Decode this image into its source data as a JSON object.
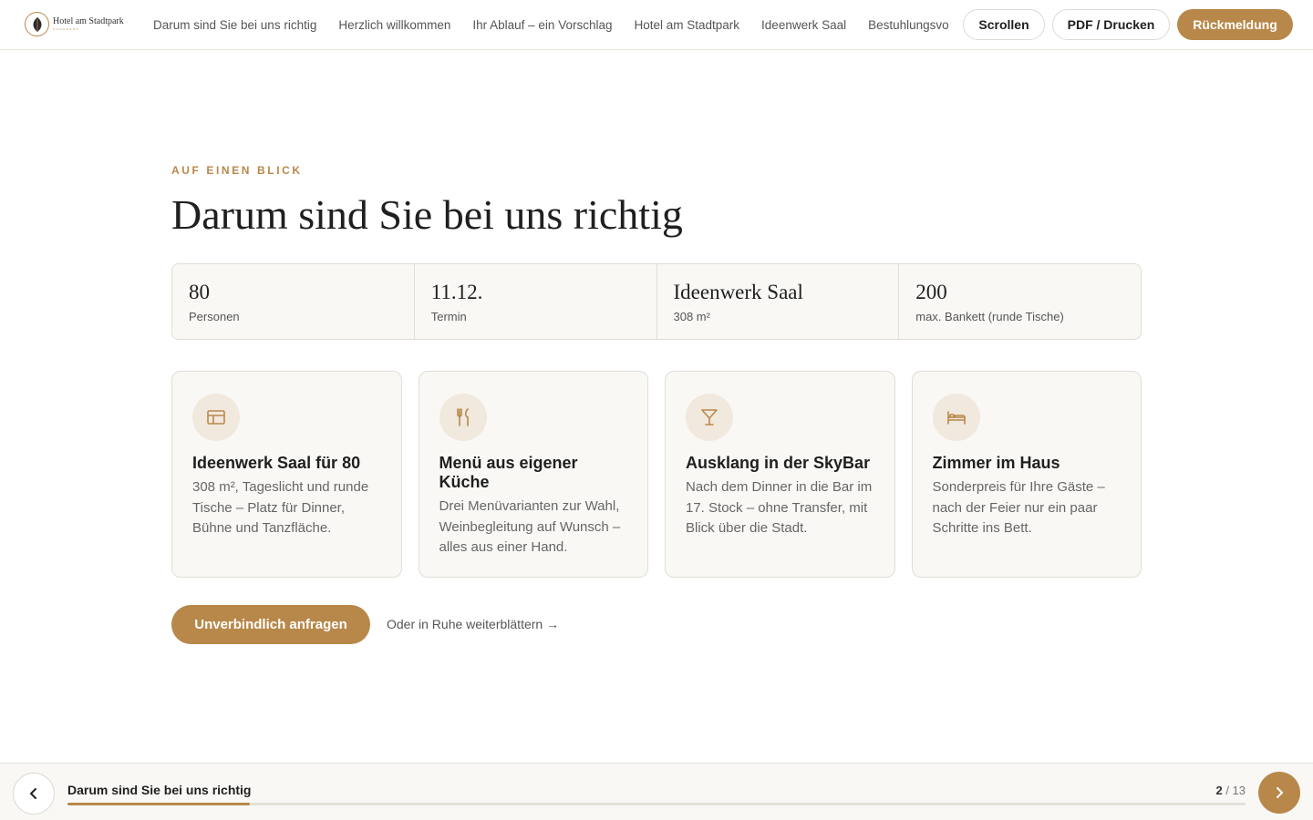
{
  "header": {
    "logo_name": "Hotel am Stadtpark",
    "logo_sub": "KONGRESS",
    "nav": [
      "Darum sind Sie bei uns richtig",
      "Herzlich willkommen",
      "Ihr Ablauf – ein Vorschlag",
      "Hotel am Stadtpark",
      "Ideenwerk Saal",
      "Bestuhlungsvorschläge"
    ],
    "scroll_label": "Scrollen",
    "pdf_label": "PDF / Drucken",
    "feedback_label": "Rückmeldung"
  },
  "main": {
    "eyebrow": "AUF EINEN BLICK",
    "title": "Darum sind Sie bei uns richtig",
    "facts": [
      {
        "value": "80",
        "label": "Personen"
      },
      {
        "value": "11.12.",
        "label": "Termin"
      },
      {
        "value": "Ideenwerk Saal",
        "label": "308 m²"
      },
      {
        "value": "200",
        "label": "max. Bankett (runde Tische)"
      }
    ],
    "cards": [
      {
        "icon": "layout-icon",
        "title": "Ideenwerk Saal für 80",
        "text": "308 m², Tageslicht und runde Tische – Platz für Dinner, Bühne und Tanzfläche."
      },
      {
        "icon": "cutlery-icon",
        "title": "Menü aus eigener Küche",
        "text": "Drei Menüvarianten zur Wahl, Weinbegleitung auf Wunsch – alles aus einer Hand."
      },
      {
        "icon": "cocktail-icon",
        "title": "Ausklang in der SkyBar",
        "text": "Nach dem Dinner in die Bar im 17. Stock – ohne Transfer, mit Blick über die Stadt."
      },
      {
        "icon": "bed-icon",
        "title": "Zimmer im Haus",
        "text": "Sonderpreis für Ihre Gäste – nach der Feier nur ein paar Schritte ins Bett."
      }
    ],
    "cta_label": "Unverbindlich anfragen",
    "browse_label": "Oder in Ruhe weiterblättern →"
  },
  "footer": {
    "current_title": "Darum sind Sie bei uns richtig",
    "page_current": "2",
    "page_total": "/ 13",
    "progress": 0.155
  },
  "colors": {
    "accent": "#b8884a",
    "card_bg": "#f9f8f5",
    "icon_bg": "#f1e8de",
    "border": "#e2ded6"
  }
}
